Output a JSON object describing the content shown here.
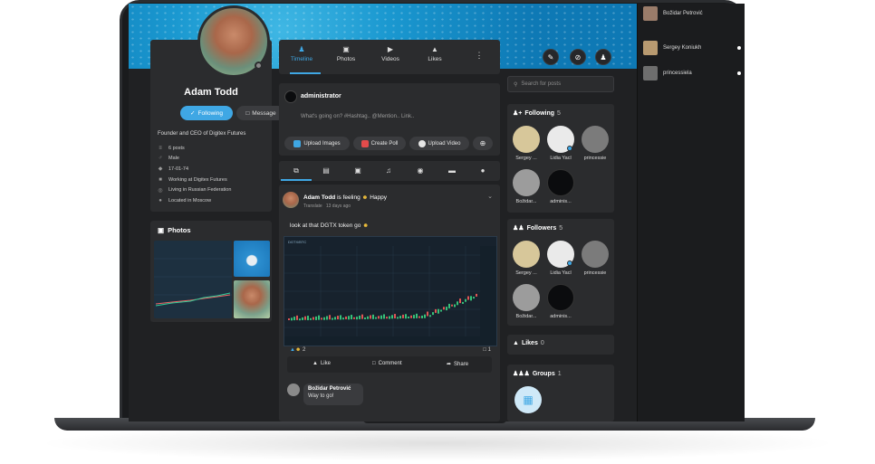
{
  "right_rail": {
    "users": [
      {
        "name": "Božidar Petrović"
      },
      {
        "name": "Sergey Koniukh"
      },
      {
        "name": "princessiela"
      }
    ]
  },
  "profile": {
    "name": "Adam Todd",
    "follow_label": "Following",
    "message_label": "Message",
    "bio": "Founder and CEO of Digitex Futures",
    "info": [
      {
        "icon": "posts-icon",
        "text": "6 posts"
      },
      {
        "icon": "gender-icon",
        "text": "Male"
      },
      {
        "icon": "birthday-icon",
        "text": "17-01-74"
      },
      {
        "icon": "work-icon",
        "text": "Working at Digitex Futures"
      },
      {
        "icon": "globe-icon",
        "text": "Living in Russian Federation"
      },
      {
        "icon": "location-icon",
        "text": "Located in Moscow"
      }
    ]
  },
  "photos": {
    "title": "Photos"
  },
  "tabs": [
    {
      "label": "Timeline",
      "active": true
    },
    {
      "label": "Photos"
    },
    {
      "label": "Videos"
    },
    {
      "label": "Likes"
    }
  ],
  "composer": {
    "author": "administrator",
    "placeholder": "What's going on? #Hashtag.. @Mention.. Link..",
    "buttons": {
      "upload_images": "Upload Images",
      "create_poll": "Create Poll",
      "upload_video": "Upload Video"
    }
  },
  "post": {
    "author": "Adam Todd",
    "feeling_text": "is feeling",
    "feeling": "Happy",
    "translate": "Translate",
    "time": "13 days ago",
    "text": "look at that DGTX token go",
    "reactions_count": "2",
    "comments_count": "1",
    "actions": {
      "like": "Like",
      "comment": "Comment",
      "share": "Share"
    },
    "chart_symbol": "DGTX/BTC",
    "comment": {
      "author": "Božidar Petrović",
      "text": "Way to go!"
    }
  },
  "search": {
    "placeholder": "Search for posts"
  },
  "following": {
    "title": "Following",
    "count": "5",
    "people": [
      "Sergey ...",
      "Lidia Yacl",
      "princessie",
      "Božidar...",
      "adminis..."
    ]
  },
  "followers": {
    "title": "Followers",
    "count": "5",
    "people": [
      "Sergey ...",
      "Lidia Yacl",
      "princessie",
      "Božidar...",
      "adminis..."
    ]
  },
  "likes": {
    "title": "Likes",
    "count": "0"
  },
  "groups": {
    "title": "Groups",
    "count": "1"
  },
  "colors": {
    "accent": "#3fa7e4",
    "card": "#2b2c2e",
    "bg": "#202123"
  }
}
